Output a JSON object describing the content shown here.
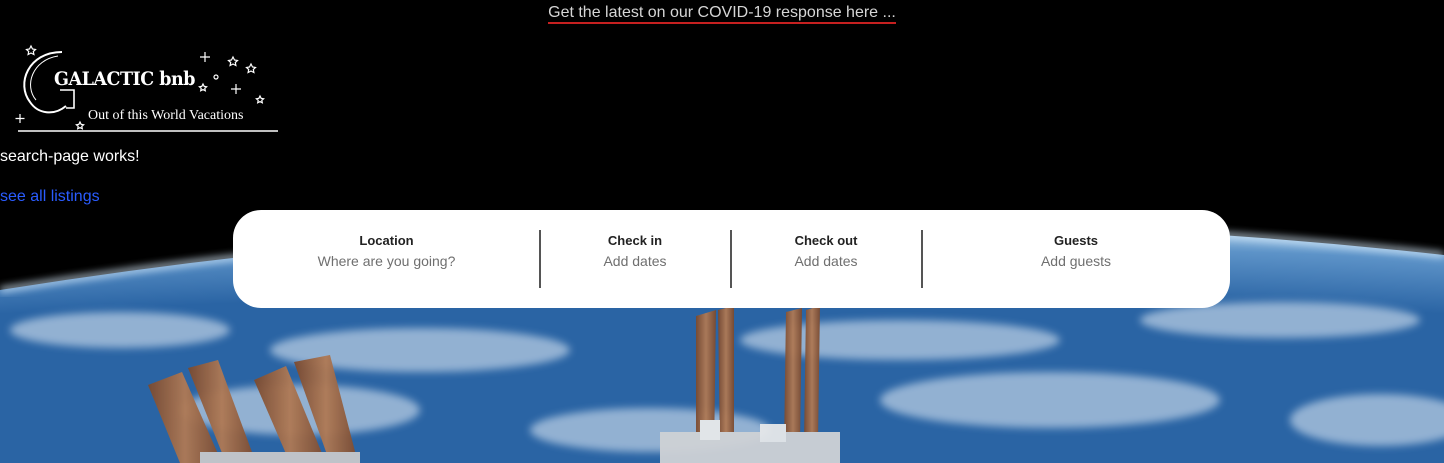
{
  "banner": {
    "covid_link_text": "Get the latest on our COVID-19 response here ..."
  },
  "logo": {
    "title": "GALACTIC bnb",
    "tagline": "Out of this World Vacations"
  },
  "page": {
    "debug_text": "search-page works!",
    "all_listings_link": "see all listings"
  },
  "search": {
    "location": {
      "label": "Location",
      "placeholder": "Where are you going?"
    },
    "checkin": {
      "label": "Check in",
      "placeholder": "Add dates"
    },
    "checkout": {
      "label": "Check out",
      "placeholder": "Add dates"
    },
    "guests": {
      "label": "Guests",
      "placeholder": "Add guests"
    }
  },
  "colors": {
    "banner_underline": "#c62020",
    "link": "#2a5cff",
    "search_bg": "#ffffff",
    "divider": "#555555"
  },
  "background": {
    "depiction": "earth-horizon-with-space-station"
  }
}
